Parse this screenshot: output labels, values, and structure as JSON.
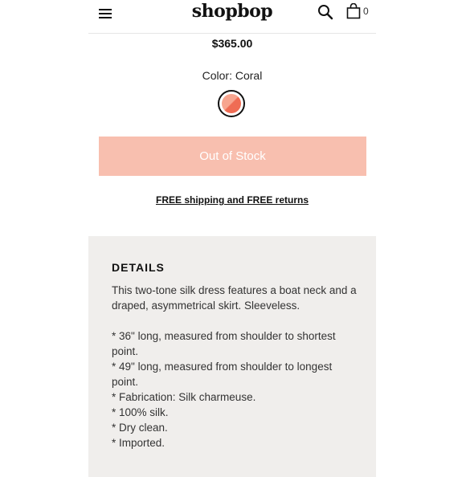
{
  "header": {
    "logo": "shopbop",
    "bag_count": "0"
  },
  "product": {
    "price": "$365.00",
    "color_label": "Color: Coral",
    "swatch_colors": [
      "#f7a58f",
      "#ef6c54"
    ],
    "stock_button": "Out of Stock",
    "shipping_text": "FREE shipping and FREE returns"
  },
  "details": {
    "title": "DETAILS",
    "description": "This two-tone silk dress features a boat neck and a draped, asymmetrical skirt. Sleeveless.",
    "bullets": [
      "* 36\" long, measured from shoulder to shortest point.",
      "* 49\" long, measured from shoulder to longest point.",
      "* Fabrication: Silk charmeuse.",
      "* 100% silk.",
      "* Dry clean.",
      "* Imported."
    ]
  },
  "colors": {
    "button_bg": "#f8bfaf",
    "details_bg": "#f0eeec"
  }
}
